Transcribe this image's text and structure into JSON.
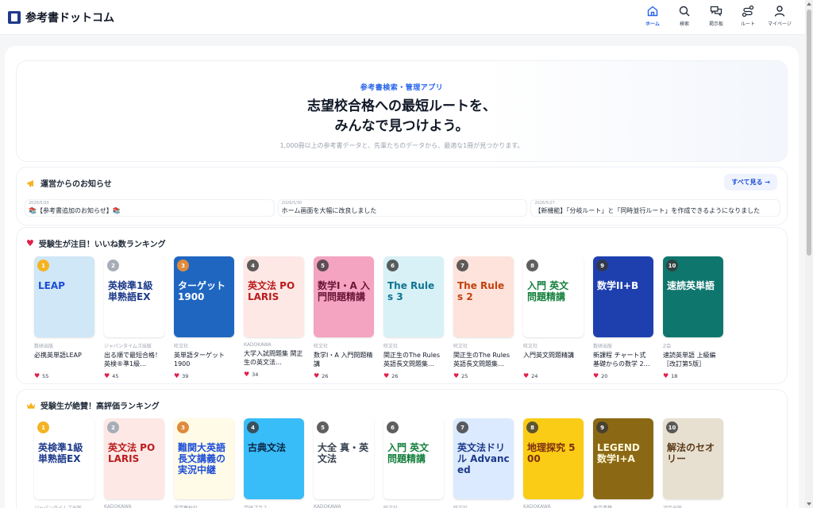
{
  "header": {
    "logo": "参考書ドットコム",
    "nav": [
      {
        "label": "ホーム",
        "icon": "home-icon",
        "active": true
      },
      {
        "label": "検索",
        "icon": "search-icon",
        "active": false
      },
      {
        "label": "掲示板",
        "icon": "chat-icon",
        "active": false
      },
      {
        "label": "ルート",
        "icon": "route-icon",
        "active": false
      },
      {
        "label": "マイページ",
        "icon": "user-icon",
        "active": false
      }
    ]
  },
  "hero": {
    "tag": "参考書検索・管理アプリ",
    "title_line1": "志望校合格への最短ルートを、",
    "title_line2": "みんなで見つけよう。",
    "subtitle": "1,000冊以上の参考書データと、先輩たちのデータから、最適な1冊が見つかります。"
  },
  "notices": {
    "title": "運営からのお知らせ",
    "see_all": "すべて見る →",
    "items": [
      {
        "date": "2026/5/30",
        "title": "📚【参考書追加のお知らせ】📚"
      },
      {
        "date": "2026/5/30",
        "title": "ホーム画面を大幅に改良しました"
      },
      {
        "date": "2026/5/27",
        "title": "【新機能】「分岐ルート」と「同時並行ルート」を作成できるようになりました"
      }
    ]
  },
  "likes_ranking": {
    "title": "受験生が注目！いいね数ランキング",
    "books": [
      {
        "rank": "1",
        "publisher": "数研出版",
        "title": "必携英単語LEAP",
        "likes": "55",
        "cover_text": "LEAP",
        "bg": "#cfe7f7",
        "fg": "#1d4ed8"
      },
      {
        "rank": "2",
        "publisher": "ジャパンタイムズ出版",
        "title": "出る順で最短合格！英検®準1級…",
        "likes": "45",
        "cover_text": "英検準1級 単熟語EX",
        "bg": "#ffffff",
        "fg": "#1e3a8a"
      },
      {
        "rank": "3",
        "publisher": "旺文社",
        "title": "英単語ターゲット1900",
        "likes": "39",
        "cover_text": "ターゲット 1900",
        "bg": "#1f66c1",
        "fg": "#ffffff"
      },
      {
        "rank": "4",
        "publisher": "KADOKAWA",
        "title": "大学入試問題集 関正生の英文法…",
        "likes": "34",
        "cover_text": "英文法 POLARIS",
        "bg": "#fde8e6",
        "fg": "#b91c1c"
      },
      {
        "rank": "5",
        "publisher": "旺文社",
        "title": "数学I・A 入門問題精講",
        "likes": "26",
        "cover_text": "数学I・A 入門問題精講",
        "bg": "#f4a3c0",
        "fg": "#6b1537"
      },
      {
        "rank": "6",
        "publisher": "旺文社",
        "title": "関正生のThe Rules 英語長文問題集…",
        "likes": "26",
        "cover_text": "The Rules 3",
        "bg": "#d8f1f6",
        "fg": "#0e7490"
      },
      {
        "rank": "7",
        "publisher": "旺文社",
        "title": "関正生のThe Rules 英語長文問題集…",
        "likes": "25",
        "cover_text": "The Rules 2",
        "bg": "#fde3dc",
        "fg": "#c2410c"
      },
      {
        "rank": "8",
        "publisher": "旺文社",
        "title": "入門英文問題精講",
        "likes": "24",
        "cover_text": "入門 英文 問題精講",
        "bg": "#ffffff",
        "fg": "#15803d"
      },
      {
        "rank": "9",
        "publisher": "数研出版",
        "title": "新課程 チャート式 基礎からの数学 2…",
        "likes": "20",
        "cover_text": "数学II+B",
        "bg": "#1e40af",
        "fg": "#ffffff"
      },
      {
        "rank": "10",
        "publisher": "Z会",
        "title": "速読英単語 上級編［改訂第5版］",
        "likes": "18",
        "cover_text": "速読英単語",
        "bg": "#0f766e",
        "fg": "#ffffff"
      }
    ]
  },
  "rating_ranking": {
    "title": "受験生が絶賛！高評価ランキング",
    "books": [
      {
        "rank": "1",
        "publisher": "ジャパンタイムズ出版",
        "cover_text": "英検準1級 単熟語EX",
        "bg": "#ffffff",
        "fg": "#1e3a8a"
      },
      {
        "rank": "2",
        "publisher": "KADOKAWA",
        "cover_text": "英文法 POLARIS",
        "bg": "#fde8e6",
        "fg": "#b91c1c"
      },
      {
        "rank": "3",
        "publisher": "語学春秋社",
        "cover_text": "難関大英語長文講義の実況中継",
        "bg": "#fffbe6",
        "fg": "#1d4ed8"
      },
      {
        "rank": "4",
        "publisher": "学研プラス",
        "cover_text": "古典文法",
        "bg": "#38bdf8",
        "fg": "#0c2340"
      },
      {
        "rank": "5",
        "publisher": "KADOKAWA",
        "cover_text": "大全 真・英文法",
        "bg": "#ffffff",
        "fg": "#374151"
      },
      {
        "rank": "6",
        "publisher": "旺文社",
        "cover_text": "入門 英文 問題精講",
        "bg": "#ffffff",
        "fg": "#15803d"
      },
      {
        "rank": "7",
        "publisher": "旺文社",
        "cover_text": "英文法ドリル Advanced",
        "bg": "#dbeafe",
        "fg": "#1e3a8a"
      },
      {
        "rank": "8",
        "publisher": "KADOKAWA",
        "cover_text": "地理探究 500",
        "bg": "#facc15",
        "fg": "#7c2d12"
      },
      {
        "rank": "9",
        "publisher": "東京書籍",
        "cover_text": "LEGEND 数学I+A",
        "bg": "#8b6914",
        "fg": "#fff8dc"
      },
      {
        "rank": "10",
        "publisher": "河合出版",
        "cover_text": "解法のセオリー",
        "bg": "#e7e0d0",
        "fg": "#5b3a1a"
      }
    ]
  },
  "colors": {
    "accent": "#2563eb",
    "heart": "#e11d48",
    "crown": "#f5b321"
  }
}
